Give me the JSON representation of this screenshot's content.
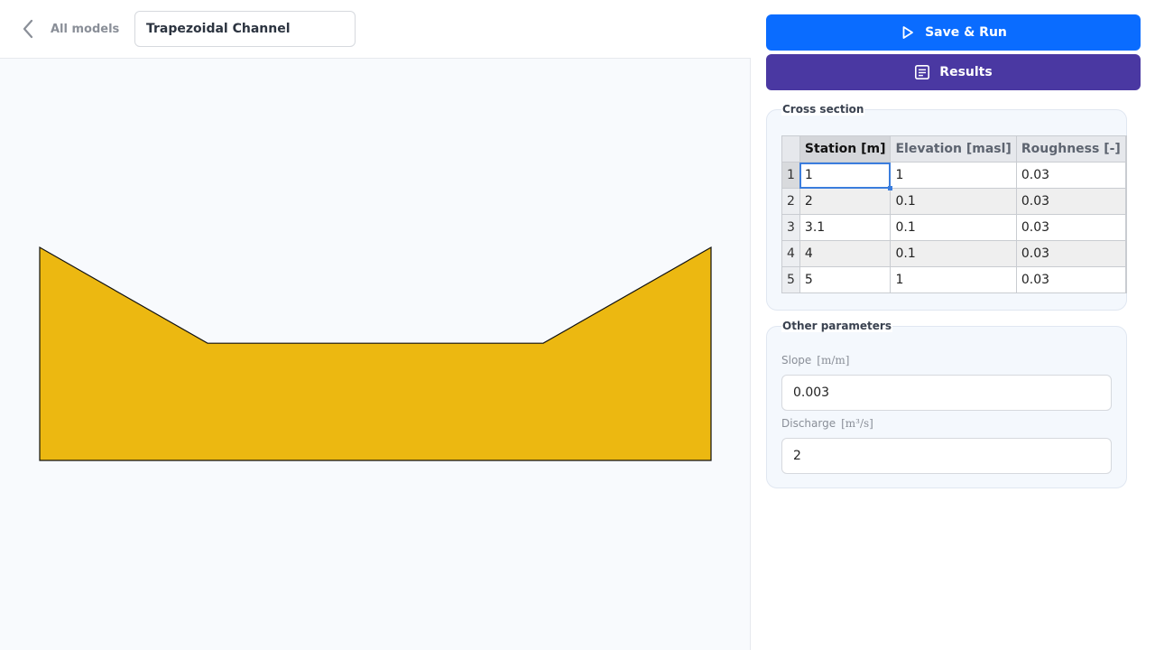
{
  "header": {
    "back_label": "All models",
    "model_name": "Trapezoidal Channel"
  },
  "actions": {
    "run_label": "Save & Run",
    "results_label": "Results"
  },
  "cross_section": {
    "legend": "Cross section",
    "columns": [
      "Station [m]",
      "Elevation [masl]",
      "Roughness [-]"
    ],
    "rows": [
      {
        "index": "1",
        "station": "1",
        "elevation": "1",
        "roughness": "0.03"
      },
      {
        "index": "2",
        "station": "2",
        "elevation": "0.1",
        "roughness": "0.03"
      },
      {
        "index": "3",
        "station": "3.1",
        "elevation": "0.1",
        "roughness": "0.03"
      },
      {
        "index": "4",
        "station": "4",
        "elevation": "0.1",
        "roughness": "0.03"
      },
      {
        "index": "5",
        "station": "5",
        "elevation": "1",
        "roughness": "0.03"
      }
    ]
  },
  "other_parameters": {
    "legend": "Other parameters",
    "slope": {
      "label": "Slope",
      "unit": "[m/m]",
      "value": "0.003"
    },
    "discharge": {
      "label": "Discharge",
      "unit": "[m³/s]",
      "value": "2"
    }
  },
  "colors": {
    "channel_fill": "#ecb811",
    "run_button": "#0a6cff",
    "results_button": "#4a38a2"
  },
  "icons": {
    "back": "chevron-left-icon",
    "run": "play-icon",
    "results": "document-icon"
  }
}
